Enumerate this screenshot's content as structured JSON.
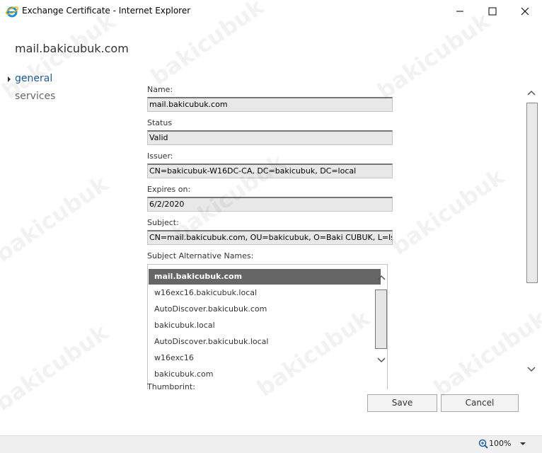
{
  "window": {
    "title": "Exchange Certificate - Internet Explorer",
    "icon": "ie-icon"
  },
  "certificate": {
    "heading": "mail.bakicubuk.com"
  },
  "nav": {
    "items": [
      {
        "label": "general",
        "selected": true
      },
      {
        "label": "services",
        "selected": false
      }
    ]
  },
  "fields": {
    "name": {
      "label": "Name:",
      "value": "mail.bakicubuk.com"
    },
    "status": {
      "label": "Status",
      "value": "Valid"
    },
    "issuer": {
      "label": "Issuer:",
      "value": "CN=bakicubuk-W16DC-CA, DC=bakicubuk, DC=local"
    },
    "expires": {
      "label": "Expires on:",
      "value": "6/2/2020"
    },
    "subject": {
      "label": "Subject:",
      "value": "CN=mail.bakicubuk.com, OU=bakicubuk, O=Baki CUBUK, L=Ista"
    },
    "san": {
      "label": "Subject Alternative Names:",
      "items": [
        "mail.bakicubuk.com",
        "w16exc16.bakicubuk.local",
        "AutoDiscover.bakicubuk.com",
        "bakicubuk.local",
        "AutoDiscover.bakicubuk.local",
        "w16exc16",
        "bakicubuk.com"
      ],
      "selected_index": 0
    },
    "thumbprint": {
      "label": "Thumbprint:"
    }
  },
  "buttons": {
    "save": "Save",
    "cancel": "Cancel"
  },
  "statusbar": {
    "zoom": "100%"
  },
  "watermark": "bakicubuk",
  "colors": {
    "nav_selected": "#1e5d99",
    "selection_bg": "#666666",
    "field_bg": "#e8e8e8"
  }
}
